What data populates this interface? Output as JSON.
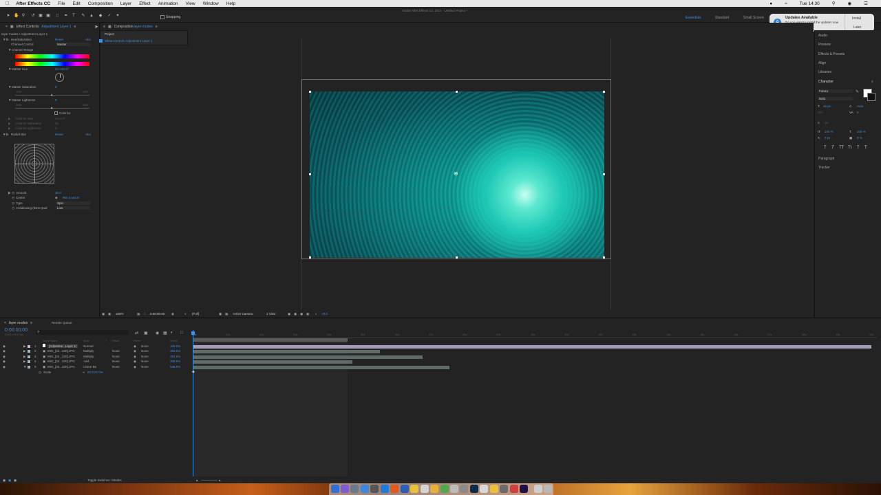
{
  "menubar": {
    "app": "After Effects CC",
    "items": [
      "File",
      "Edit",
      "Composition",
      "Layer",
      "Effect",
      "Animation",
      "View",
      "Window",
      "Help"
    ],
    "clock": "Tue 14:30"
  },
  "toolbar": {
    "snapping": "Snapping",
    "window_title": "Adobe After Effects CC 2017 - Untitled Project *",
    "workspaces": [
      "Essentials",
      "Standard",
      "Small Screen"
    ]
  },
  "notification": {
    "title": "Updates Available",
    "body": "Do you want to install the updates now or try tonight?",
    "install": "Install",
    "later": "Later"
  },
  "effect_controls": {
    "tab": "Effect Controls",
    "tab_layer": "Adjustment Layer 1",
    "breadcrumb": "layer modes • Adjustment Layer 1",
    "hue": {
      "name": "Hue/Saturation",
      "reset": "Reset",
      "about": "Abo",
      "channel_control_label": "Channel Control",
      "channel_control_value": "Master",
      "channel_range": "Channel Range",
      "master_hue": "Master Hue",
      "master_hue_value": "0x+333.0°",
      "master_sat": "Master Saturation",
      "master_sat_value": "0",
      "sat_min": "-100",
      "sat_max": "100",
      "master_light": "Master Lightness",
      "master_light_value": "0",
      "light_min": "-100",
      "light_max": "100",
      "colorize": "Colorize",
      "colorize_hue": "Colorize Hue",
      "colorize_hue_value": "0x+0.0°",
      "colorize_sat": "Colorize Saturation",
      "colorize_sat_value": "25",
      "colorize_light": "Colorize Lightness",
      "colorize_light_value": "0"
    },
    "radial": {
      "name": "Radial Blur",
      "reset": "Reset",
      "about": "Abo",
      "amount": "Amount",
      "amount_value": "30.0",
      "center": "Center",
      "center_value": "960.0,540.0",
      "type": "Type",
      "type_value": "Spin",
      "aa": "Antialiasing (Best Qual",
      "aa_value": "Low"
    }
  },
  "project": {
    "tab": "Project",
    "item": "Effect Controls Adjustment Layer 1"
  },
  "composition": {
    "tab": "Composition",
    "tab_name": "layer modes",
    "zoom": "100%",
    "time": "0:00:00:00",
    "quality": "(Full)",
    "camera": "Active Camera",
    "views": "1 View",
    "exposure": "+0.0"
  },
  "right_panel": {
    "items": [
      "Audio",
      "Preview",
      "Effects & Presets",
      "Align",
      "Libraries",
      "Character"
    ],
    "font": "Futura",
    "style": "Bold",
    "size": "46 px",
    "leading": "Auto",
    "tracking": "0",
    "scale_v": "100 %",
    "scale_h": "100 %",
    "baseline": "0 px",
    "tsume": "0 %",
    "stroke": "- px",
    "lower": [
      "Paragraph",
      "Tracker"
    ]
  },
  "timeline": {
    "tab": "layer modes",
    "render_queue": "Render Queue",
    "timecode": "0:00:00:00",
    "fps": "00000 (25.00 fps)",
    "headers": [
      "Source Name",
      "Mode",
      "T",
      "TrkMat",
      "Parent",
      "Stretch"
    ],
    "layers": [
      {
        "num": "1",
        "name": "[Adjustme...Layer 1]",
        "mode": "Normal",
        "trk": "",
        "parent": "None",
        "stretch": "100.0%"
      },
      {
        "num": "2",
        "name": "IMG_[42...320].JPG",
        "mode": "Multiply",
        "trk": "None",
        "parent": "None",
        "stretch": "393.0%"
      },
      {
        "num": "3",
        "name": "IMG_[42...320].JPG",
        "mode": "Multiply",
        "trk": "None",
        "parent": "None",
        "stretch": "482.0%"
      },
      {
        "num": "4",
        "name": "IMG_[42...320].JPG",
        "mode": "Add",
        "trk": "None",
        "parent": "None",
        "stretch": "358.0%"
      },
      {
        "num": "5",
        "name": "IMG_[42...320].JPG",
        "mode": "Linear Bu",
        "trk": "None",
        "parent": "None",
        "stretch": "538.0%"
      }
    ],
    "scale_label": "Scale",
    "scale_value": "82.0,82.0%",
    "ruler": [
      "00s",
      "01s",
      "02s",
      "03s",
      "04s",
      "05s",
      "06s",
      "07s",
      "08s",
      "09s",
      "10s",
      "11s",
      "12s",
      "13s",
      "14s",
      "15s",
      "16s",
      "17s",
      "18s",
      "19s",
      "20s"
    ],
    "toggle": "Toggle Switches / Modes"
  }
}
